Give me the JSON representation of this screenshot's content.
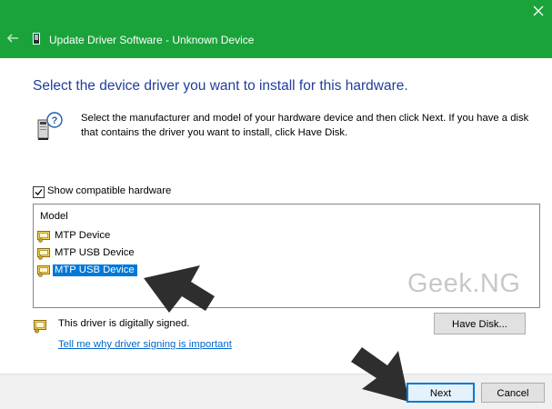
{
  "window": {
    "title": "Update Driver Software - Unknown Device",
    "accent": "#1aa33a",
    "back_icon": "back-arrow-icon",
    "close_icon": "close-icon"
  },
  "heading": "Select the device driver you want to install for this hardware.",
  "instructions": "Select the manufacturer and model of your hardware device and then click Next. If you have a disk that contains the driver you want to install, click Have Disk.",
  "compatible": {
    "label": "Show compatible hardware",
    "checked": true
  },
  "model_list": {
    "header": "Model",
    "items": [
      {
        "label": "MTP Device",
        "selected": false
      },
      {
        "label": "MTP USB Device",
        "selected": false
      },
      {
        "label": "MTP USB Device",
        "selected": true
      }
    ]
  },
  "watermark": "Geek.NG",
  "signing": {
    "status": "This driver is digitally signed.",
    "link": "Tell me why driver signing is important"
  },
  "buttons": {
    "have_disk": "Have Disk...",
    "next": "Next",
    "cancel": "Cancel"
  }
}
